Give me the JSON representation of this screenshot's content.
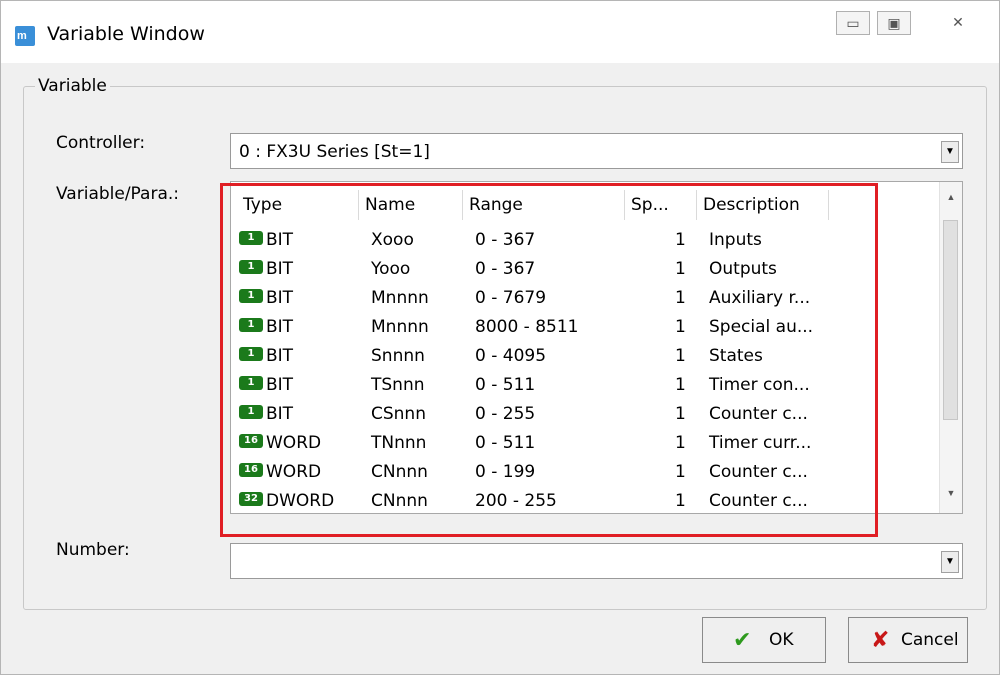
{
  "window": {
    "title": "Variable Window",
    "buttons": [
      "minimize",
      "maximize",
      "close"
    ]
  },
  "group": {
    "label": "Variable"
  },
  "controller": {
    "label": "Controller:",
    "value": "0 : FX3U Series [St=1]"
  },
  "variable": {
    "label": "Variable/Para.:"
  },
  "number": {
    "label": "Number:",
    "value": ""
  },
  "table": {
    "headers": [
      "Type",
      "Name",
      "Range",
      "Sp...",
      "Description"
    ],
    "rows": [
      {
        "badge": "1",
        "type": "BIT",
        "name": "Xooo",
        "range": "0 - 367",
        "sp": "1",
        "desc": "Inputs"
      },
      {
        "badge": "1",
        "type": "BIT",
        "name": "Yooo",
        "range": "0 - 367",
        "sp": "1",
        "desc": "Outputs"
      },
      {
        "badge": "1",
        "type": "BIT",
        "name": "Mnnnn",
        "range": "0 - 7679",
        "sp": "1",
        "desc": "Auxiliary r..."
      },
      {
        "badge": "1",
        "type": "BIT",
        "name": "Mnnnn",
        "range": "8000 - 8511",
        "sp": "1",
        "desc": "Special au..."
      },
      {
        "badge": "1",
        "type": "BIT",
        "name": "Snnnn",
        "range": "0 - 4095",
        "sp": "1",
        "desc": "States"
      },
      {
        "badge": "1",
        "type": "BIT",
        "name": "TSnnn",
        "range": "0 - 511",
        "sp": "1",
        "desc": "Timer con..."
      },
      {
        "badge": "1",
        "type": "BIT",
        "name": "CSnnn",
        "range": "0 - 255",
        "sp": "1",
        "desc": "Counter c..."
      },
      {
        "badge": "16",
        "type": "WORD",
        "name": "TNnnn",
        "range": "0 - 511",
        "sp": "1",
        "desc": "Timer curr..."
      },
      {
        "badge": "16",
        "type": "WORD",
        "name": "CNnnn",
        "range": "0 - 199",
        "sp": "1",
        "desc": "Counter c..."
      },
      {
        "badge": "32",
        "type": "DWORD",
        "name": "CNnnn",
        "range": "200 - 255",
        "sp": "1",
        "desc": "Counter c..."
      }
    ]
  },
  "actions": {
    "ok": "OK",
    "cancel": "Cancel"
  },
  "colors": {
    "highlight": "#e01e24",
    "badge": "#1b7a1b"
  }
}
